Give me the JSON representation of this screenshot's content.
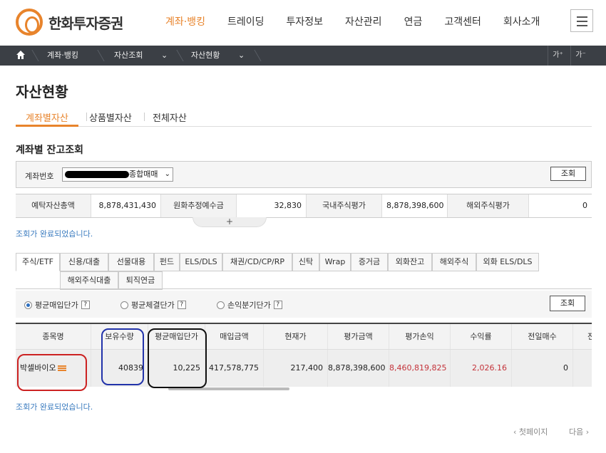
{
  "header": {
    "brand": "한화투자증권",
    "nav": [
      "계좌·뱅킹",
      "트레이딩",
      "투자정보",
      "자산관리",
      "연금",
      "고객센터",
      "회사소개"
    ],
    "active_nav": "계좌·뱅킹"
  },
  "breadcrumb": {
    "items": [
      "계좌·뱅킹",
      "자산조회",
      "자산현황"
    ],
    "font_up": "가⁺",
    "font_down": "가⁻"
  },
  "page_title": "자산현황",
  "tabs": [
    "계좌별자산",
    "상품별자산",
    "전체자산"
  ],
  "section_title": "계좌별 잔고조회",
  "account": {
    "label": "계좌번호",
    "select_suffix": "종합매매",
    "query_button": "조회"
  },
  "summary": [
    {
      "label": "예탁자산총액",
      "value": "8,878,431,430"
    },
    {
      "label": "원화추정예수금",
      "value": "32,830"
    },
    {
      "label": "국내주식평가",
      "value": "8,878,398,600"
    },
    {
      "label": "해외주식평가",
      "value": "0"
    }
  ],
  "expand_symbol": "+",
  "status_message": "조회가 완료되었습니다.",
  "product_tabs_row1": [
    "주식/ETF",
    "신용/대출",
    "선물대용",
    "펀드",
    "ELS/DLS",
    "채권/CD/CP/RP",
    "신탁",
    "Wrap",
    "증거금",
    "외화잔고",
    "해외주식",
    "외화 ELS/DLS"
  ],
  "product_tabs_row2": [
    "해외주식대출",
    "퇴직연금"
  ],
  "radio_options": [
    {
      "label": "평균매입단가",
      "checked": true
    },
    {
      "label": "평균체결단가",
      "checked": false
    },
    {
      "label": "손익분기단가",
      "checked": false
    }
  ],
  "help_symbol": "?",
  "radio_query_button": "조회",
  "table": {
    "headers": [
      "종목명",
      "보유수량",
      "평균매입단가",
      "매입금액",
      "현재가",
      "평가금액",
      "평가손익",
      "수익률",
      "전일매수",
      "전"
    ],
    "rows": [
      [
        "박셀바이오",
        "40839",
        "10,225",
        "417,578,775",
        "217,400",
        "8,878,398,600",
        "8,460,819,825",
        "2,026.16",
        "0",
        ""
      ]
    ]
  },
  "annotation_colors": {
    "name": "#cc2222",
    "quantity": "#2233aa",
    "avg_price": "#111111"
  },
  "pager": {
    "first": "첫페이지",
    "next": "다음"
  },
  "colors": {
    "accent": "#e8842c",
    "dark_bar": "#3b3f45",
    "status": "#3a7bbf",
    "loss_gain": "#c4333a"
  }
}
